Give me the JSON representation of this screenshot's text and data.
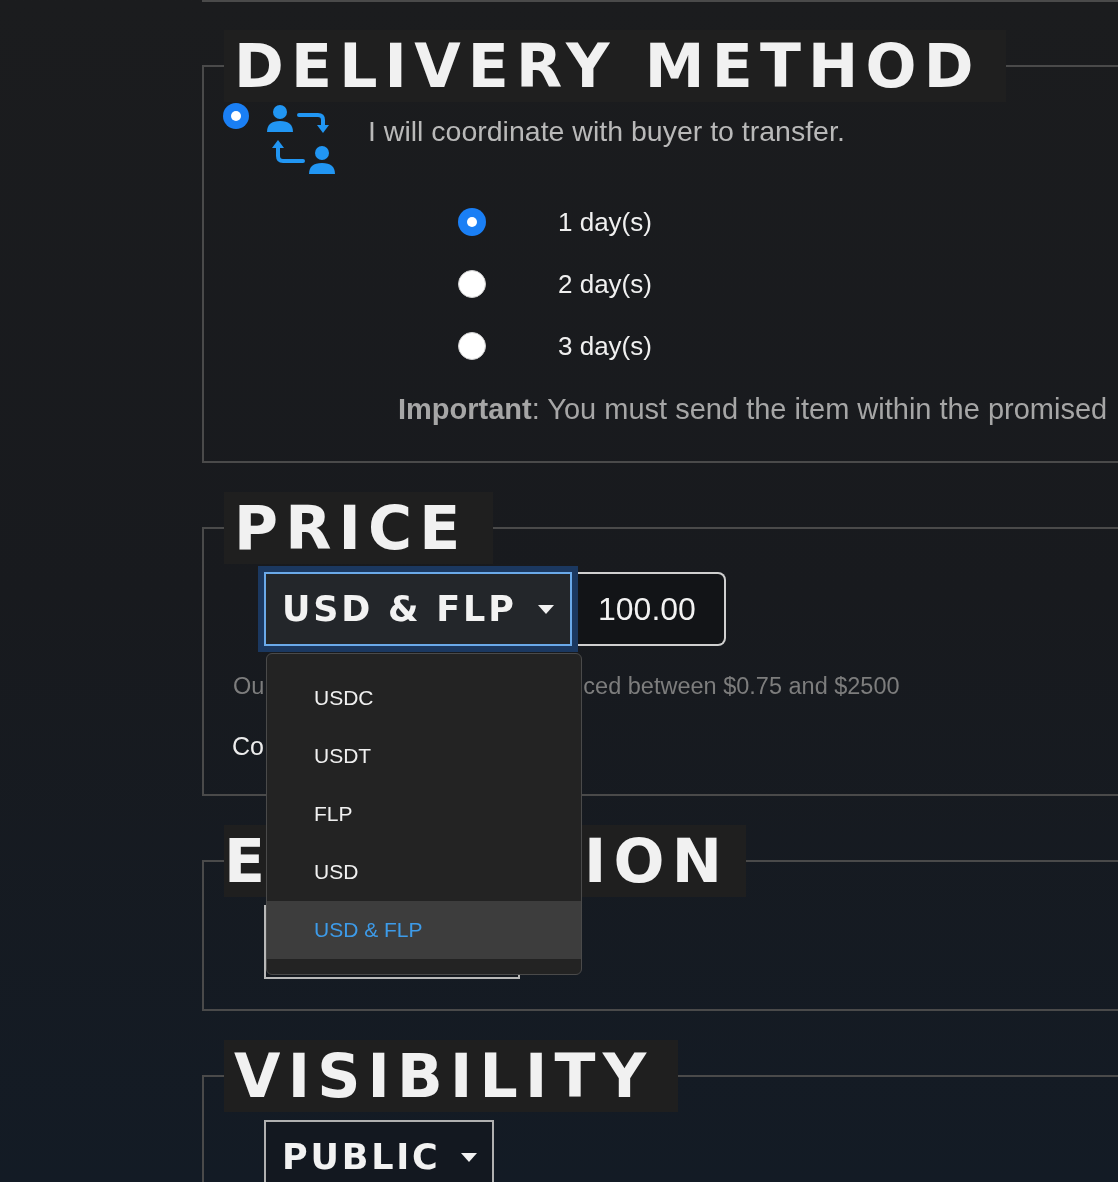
{
  "delivery_method": {
    "title": "DELIVERY METHOD",
    "option": {
      "label": "I will coordinate with buyer to transfer.",
      "selected": true
    },
    "days": [
      {
        "label": "1 day(s)",
        "selected": true
      },
      {
        "label": "2 day(s)",
        "selected": false
      },
      {
        "label": "3 day(s)",
        "selected": false
      }
    ],
    "note": "**Important**: You must send the item within the promised"
  },
  "price": {
    "title": "PRICE",
    "currency": {
      "value": "USD & FLP",
      "expanded": true,
      "options": [
        {
          "label": "USDC",
          "selected": false
        },
        {
          "label": "USDT",
          "selected": false
        },
        {
          "label": "FLP",
          "selected": false
        },
        {
          "label": "USD",
          "selected": false
        },
        {
          "label": "USD & FLP",
          "selected": true
        }
      ]
    },
    "amount": "100.00",
    "hint_parts": [
      "Ou",
      "ced between $0.75 and $2500"
    ],
    "compare_link": "Co"
  },
  "expiration": {
    "title_parts": [
      "E",
      "ION"
    ]
  },
  "visibility": {
    "title": "VISIBILITY",
    "select": {
      "value": "PUBLIC"
    }
  }
}
